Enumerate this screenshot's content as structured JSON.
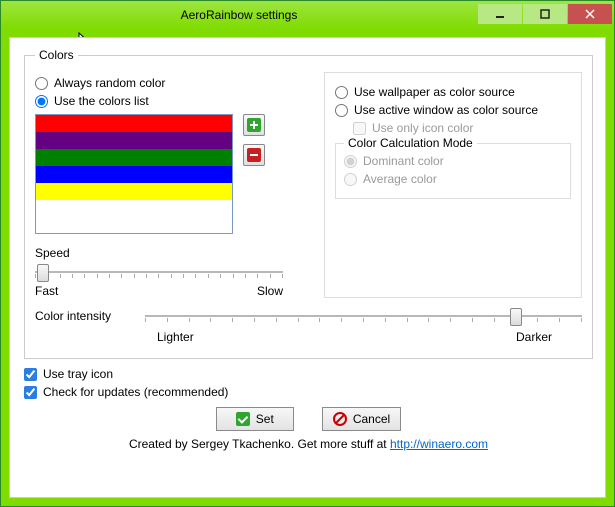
{
  "window": {
    "title": "AeroRainbow settings"
  },
  "colors_group": {
    "legend": "Colors"
  },
  "left": {
    "radio_random": "Always random color",
    "radio_list": "Use the colors list",
    "color_list": [
      "#ff0000",
      "#640082",
      "#008000",
      "#0000ff",
      "#ffff00"
    ],
    "speed_label": "Speed",
    "speed_min": "Fast",
    "speed_max": "Slow"
  },
  "right": {
    "radio_wallpaper": "Use wallpaper as color source",
    "radio_active": "Use active window as color source",
    "check_icon_only": "Use only icon color",
    "calc_legend": "Color Calculation Mode",
    "radio_dominant": "Dominant color",
    "radio_average": "Average color"
  },
  "intensity": {
    "label": "Color intensity",
    "min": "Lighter",
    "max": "Darker"
  },
  "checks": {
    "tray": "Use tray icon",
    "updates": "Check for updates (recommended)"
  },
  "buttons": {
    "set": "Set",
    "cancel": "Cancel"
  },
  "footer": {
    "text": "Created by Sergey Tkachenko. Get more stuff at  ",
    "link": "http://winaero.com"
  }
}
